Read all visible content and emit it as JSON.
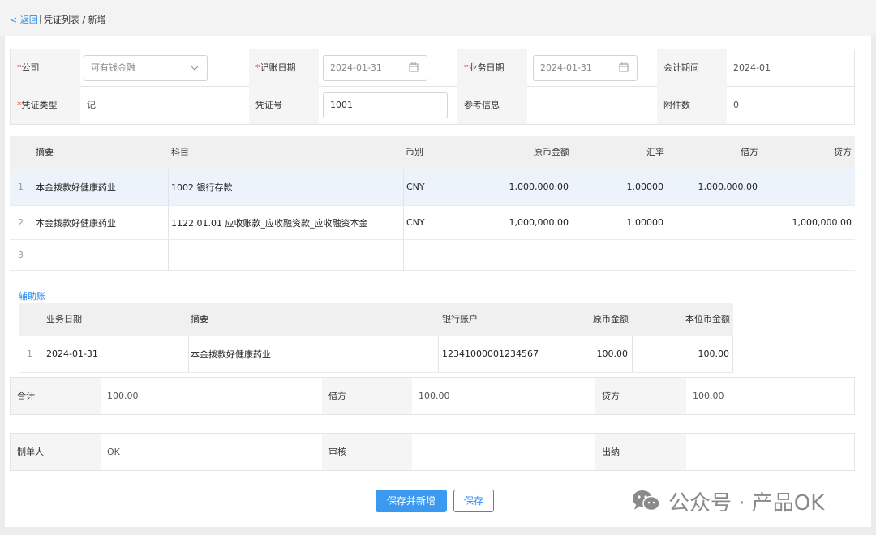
{
  "nav": {
    "back_label": "< 返回",
    "separator": "|",
    "breadcrumb": "凭证列表 / 新增"
  },
  "header": {
    "company_label": "公司",
    "company_value": "可有钱金融",
    "record_date_label": "记账日期",
    "record_date_value": "2024-01-31",
    "business_date_label": "业务日期",
    "business_date_value": "2024-01-31",
    "period_label": "会计期间",
    "period_value": "2024-01",
    "voucher_type_label": "凭证类型",
    "voucher_type_value": "记",
    "voucher_no_label": "凭证号",
    "voucher_no_value": "1001",
    "reference_label": "参考信息",
    "reference_value": "",
    "attachments_label": "附件数",
    "attachments_value": "0",
    "required_mark": "*"
  },
  "entries": {
    "columns": [
      "摘要",
      "科目",
      "币别",
      "原币金额",
      "汇率",
      "借方",
      "贷方"
    ],
    "rows": [
      {
        "no": "1",
        "summary": "本金拨款好健康药业",
        "account": "1002 银行存款",
        "currency": "CNY",
        "amount": "1,000,000.00",
        "rate": "1.00000",
        "debit": "1,000,000.00",
        "credit": ""
      },
      {
        "no": "2",
        "summary": "本金拨款好健康药业",
        "account": "1122.01.01 应收账款_应收融资款_应收融资本金",
        "currency": "CNY",
        "amount": "1,000,000.00",
        "rate": "1.00000",
        "debit": "",
        "credit": "1,000,000.00"
      },
      {
        "no": "3",
        "summary": "",
        "account": "",
        "currency": "",
        "amount": "",
        "rate": "",
        "debit": "",
        "credit": ""
      }
    ]
  },
  "aux": {
    "title": "辅助账",
    "columns": [
      "业务日期",
      "摘要",
      "银行账户",
      "原币金额",
      "本位币金额"
    ],
    "rows": [
      {
        "no": "1",
        "date": "2024-01-31",
        "summary": "本金拨款好健康药业",
        "bank_account": "12341000001234567",
        "amount": "100.00",
        "local_amount": "100.00"
      }
    ]
  },
  "totals": {
    "total_label": "合计",
    "total_value": "100.00",
    "debit_label": "借方",
    "debit_value": "100.00",
    "credit_label": "贷方",
    "credit_value": "100.00"
  },
  "signatures": {
    "maker_label": "制单人",
    "maker_value": "OK",
    "reviewer_label": "审核",
    "reviewer_value": "",
    "cashier_label": "出纳",
    "cashier_value": ""
  },
  "actions": {
    "save_new_label": "保存并新增",
    "save_label": "保存"
  },
  "watermark": {
    "text": "公众号 · 产品OK",
    "icon": "wechat-icon"
  },
  "colors": {
    "accent": "#2d8cf0",
    "required": "#e64340",
    "selected_row": "#edf3fb"
  }
}
